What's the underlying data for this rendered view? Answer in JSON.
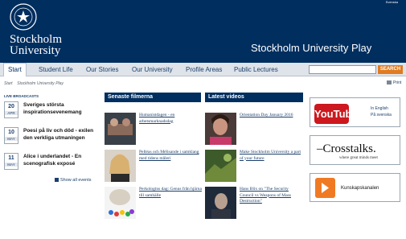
{
  "header": {
    "top_link": "Svenska",
    "logo_line1": "Stockholm",
    "logo_line2": "University",
    "site_title": "Stockholm University Play"
  },
  "nav": {
    "items": [
      {
        "label": "Start",
        "active": true
      },
      {
        "label": "Student Life"
      },
      {
        "label": "Our Stories"
      },
      {
        "label": "Our University"
      },
      {
        "label": "Profile Areas"
      },
      {
        "label": "Public Lectures"
      }
    ]
  },
  "search": {
    "placeholder": "",
    "button_label": "SEARCH"
  },
  "breadcrumb": {
    "home": "Start",
    "current": "Stockholm University Play"
  },
  "print_label": "Print",
  "live": {
    "heading": "LIVE BROADCASTS",
    "events": [
      {
        "day": "20",
        "month": "APR",
        "title": "Sveriges största inspirationsevenemang"
      },
      {
        "day": "10",
        "month": "MAY",
        "title": "Poesi på liv och död - exilen den verkliga utmaningen"
      },
      {
        "day": "11",
        "month": "MAY",
        "title": "Alice i underlandet - En scenografisk exposé"
      }
    ],
    "show_all": "Show all events"
  },
  "films": {
    "heading": "Senaste filmerna",
    "items": [
      {
        "title": "Humanistdagen - en arbetsmarknadsdag"
      },
      {
        "title": "Pelléas och Mélisande i samklang med tidens måleri"
      },
      {
        "title": "Perkologins dag: Genus från hjärna till samhälle"
      }
    ]
  },
  "videos": {
    "heading": "Latest videos",
    "items": [
      {
        "title": "Orientation Day January 2016"
      },
      {
        "title": "Make Stockholm University a part of your future"
      },
      {
        "title": "Hans Blix on \"The Security Council vs Weapons of Mass Destruction\""
      }
    ]
  },
  "ads": {
    "youtube": {
      "logo_text": "YouTube",
      "link_en": "In English",
      "link_sv": "På svenska"
    },
    "crosstalks": {
      "title": "–Crosstalks.",
      "subtitle": "where great minds meet"
    },
    "kunskapskanalen": {
      "label": "Kunskapskanalen"
    }
  },
  "colors": {
    "header_bg": "#002e5f",
    "nav_bg": "#dfe4ea",
    "search_button": "#e07b21",
    "youtube_red": "#cc181e",
    "kk_orange": "#f07a23"
  }
}
